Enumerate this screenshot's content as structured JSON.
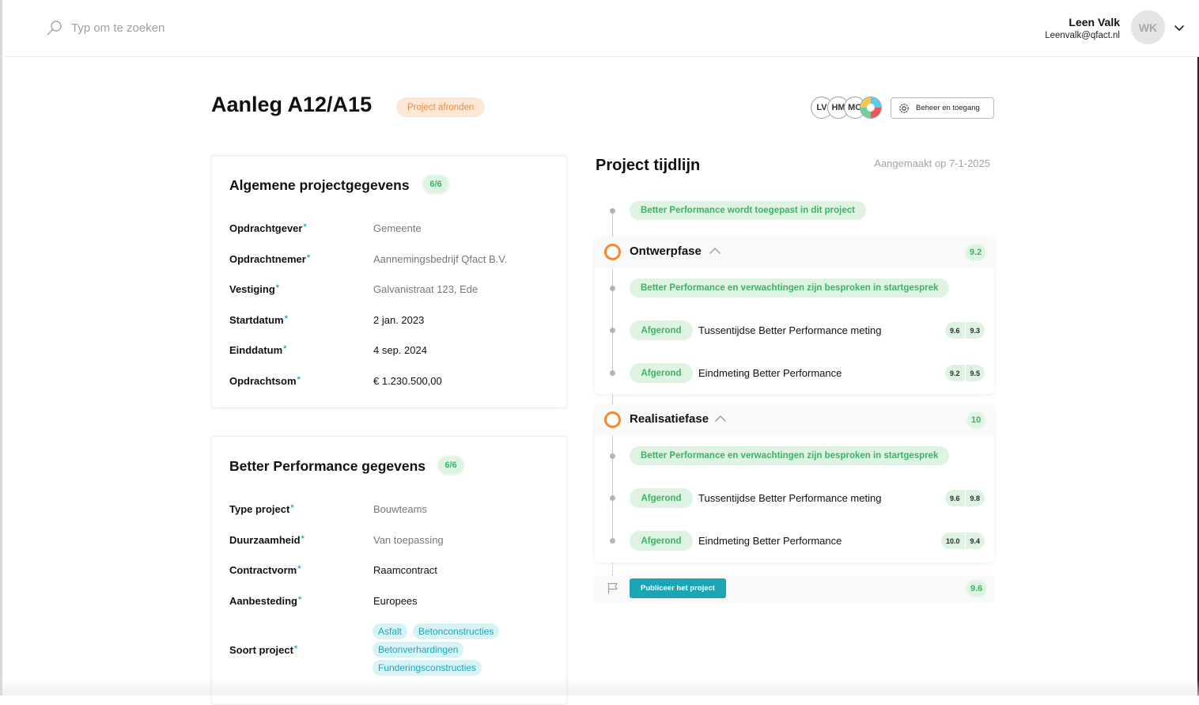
{
  "search": {
    "placeholder": "Typ om te zoeken"
  },
  "user": {
    "name": "Leen Valk",
    "email": "Leenvalk@qfact.nl",
    "initials": "WK"
  },
  "project": {
    "title": "Aanleg A12/A15",
    "status": "Project afronden",
    "members": [
      "LV",
      "HM",
      "MO"
    ],
    "manage_label": "Beheer en toegang"
  },
  "general": {
    "title": "Algemene projectgegevens",
    "count": "6/6",
    "rows": [
      {
        "label": "Opdrachtgever",
        "value": "Gemeente"
      },
      {
        "label": "Opdrachtnemer",
        "value": "Aannemingsbedrijf Qfact B.V."
      },
      {
        "label": "Vestiging",
        "value": "Galvanistraat 123, Ede"
      },
      {
        "label": "Startdatum",
        "value": "2 jan. 2023"
      },
      {
        "label": "Einddatum",
        "value": "4 sep. 2024"
      },
      {
        "label": "Opdrachtsom",
        "value": "€ 1.230.500,00"
      }
    ]
  },
  "bp": {
    "title": "Better Performance gegevens",
    "count": "6/6",
    "rows": [
      {
        "label": "Type project",
        "value": "Bouwteams"
      },
      {
        "label": "Duurzaamheid",
        "value": "Van toepassing"
      },
      {
        "label": "Contractvorm",
        "value": "Raamcontract"
      },
      {
        "label": "Aanbesteding",
        "value": "Europees"
      },
      {
        "label": "Soort project",
        "value": ""
      }
    ],
    "tags": [
      "Asfalt",
      "Betonconstructies",
      "Betonverhardingen",
      "Funderingsconstructies"
    ]
  },
  "timeline": {
    "title": "Project tijdlijn",
    "created": "Aangemaakt op 7-1-2025",
    "intro": "Better Performance wordt toegepast in dit project",
    "phases": [
      {
        "title": "Ontwerpfase",
        "score": "9.2",
        "kickoff": "Better Performance en verwachtingen zijn besproken in startgesprek",
        "items": [
          {
            "status": "Afgerond",
            "label": "Tussentijdse Better Performance meting",
            "scores": [
              "9.6",
              "9.3"
            ]
          },
          {
            "status": "Afgerond",
            "label": "Eindmeting Better Performance",
            "scores": [
              "9.2",
              "9.5"
            ]
          }
        ]
      },
      {
        "title": "Realisatiefase",
        "score": "10",
        "kickoff": "Better Performance en verwachtingen zijn besproken in startgesprek",
        "items": [
          {
            "status": "Afgerond",
            "label": "Tussentijdse Better Performance meting",
            "scores": [
              "9.6",
              "9.8"
            ]
          },
          {
            "status": "Afgerond",
            "label": "Eindmeting Better Performance",
            "scores": [
              "10.0",
              "9.4"
            ]
          }
        ]
      }
    ],
    "publish_label": "Publiceer het project",
    "final_score": "9.6"
  },
  "colors": {
    "accent": "#1ba5b5",
    "status_orange": "#f2892d",
    "green": "#3bb463",
    "green_bg": "#dff3e3",
    "tag_bg": "#d8f3f5"
  },
  "icons": [
    "search-icon",
    "chevron-down-icon",
    "gear-icon",
    "chevron-up-icon",
    "flag-icon"
  ]
}
